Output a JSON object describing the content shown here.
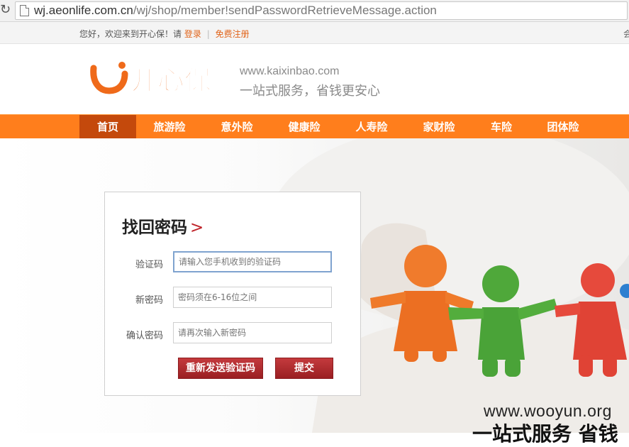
{
  "browser": {
    "url_host": "wj.aeonlife.com.cn",
    "url_path": "/wj/shop/member!sendPasswordRetrieveMessage.action"
  },
  "topbar": {
    "greeting": "您好，欢迎来到开心保！请",
    "login": "登录",
    "separator": "|",
    "register": "免费注册",
    "right_fragment": "会"
  },
  "header": {
    "logo_text": "开心保",
    "site_url": "www.kaixinbao.com",
    "slogan": "一站式服务，省钱更安心"
  },
  "nav": {
    "items": [
      "首页",
      "旅游险",
      "意外险",
      "健康险",
      "人寿险",
      "家财险",
      "车险",
      "团体险"
    ],
    "active_index": 0
  },
  "form": {
    "title": "找回密码",
    "title_arrow": ">",
    "code_label": "验证码",
    "code_placeholder": "请输入您手机收到的验证码",
    "new_password_label": "新密码",
    "new_password_placeholder": "密码须在6-16位之间",
    "confirm_label": "确认密码",
    "confirm_placeholder": "请再次输入新密码",
    "resend_button": "重新发送验证码",
    "submit_button": "提交"
  },
  "banner": {
    "watermark": "www.wooyun.org",
    "slogan_fragment": "一站式服务 省钱"
  },
  "colors": {
    "brand_orange": "#ff7e1c",
    "nav_active": "#c4490c",
    "button_red": "#b02d30"
  }
}
